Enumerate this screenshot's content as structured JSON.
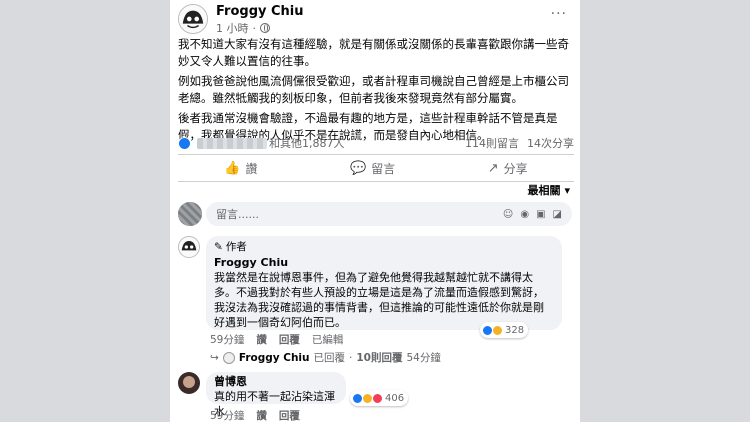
{
  "post": {
    "author": "Froggy Chiu",
    "time": "1 小時",
    "more": "···",
    "paragraphs": [
      "我不知道大家有沒有這種經驗，就是有關係或沒關係的長輩喜歡跟你講一些奇妙又令人難以置信的往事。",
      "例如我爸爸說他風流倜儻很受歡迎，或者計程車司機說自己曾經是上市櫃公司老總。雖然牴觸我的刻板印象，但前者我後來發現竟然有部分屬實。",
      "後者我通常沒機會驗證，不過最有趣的地方是，這些計程車幹話不管是真是假，我都覺得說的人似乎不是在說謊，而是發自內心地相信。"
    ]
  },
  "reactions": {
    "summary": "和其他1,887人",
    "comments": "114則留言",
    "shares": "14次分享"
  },
  "actions": {
    "like": "讚",
    "comment": "留言",
    "share": "分享"
  },
  "sort": {
    "label": "最相關",
    "caret": "▾"
  },
  "compose": {
    "placeholder": "留言......"
  },
  "comments": [
    {
      "badge": "作者",
      "author": "Froggy Chiu",
      "text": "我當然是在說博恩事件，但為了避免他覺得我越幫越忙就不講得太多。不過我對於有些人預設的立場是這是為了流量而造假感到驚訝，我沒法為我沒確認過的事情背書，但這推論的可能性遠低於你就是剛好遇到一個奇幻阿伯而已。",
      "time": "59分鐘",
      "like": "讚",
      "reply": "回覆",
      "edited": "已編輯",
      "reaction_count": "328"
    },
    {
      "author": "曾博恩",
      "text": "真的用不著一起沾染這渾水",
      "time": "59分鐘",
      "like": "讚",
      "reply": "回覆",
      "reaction_count": "406"
    }
  ],
  "reply_summary": {
    "arrow": "↪",
    "name": "Froggy Chiu",
    "action": "已回覆",
    "sep": "·",
    "count": "10則回覆",
    "time": "54分鐘"
  }
}
